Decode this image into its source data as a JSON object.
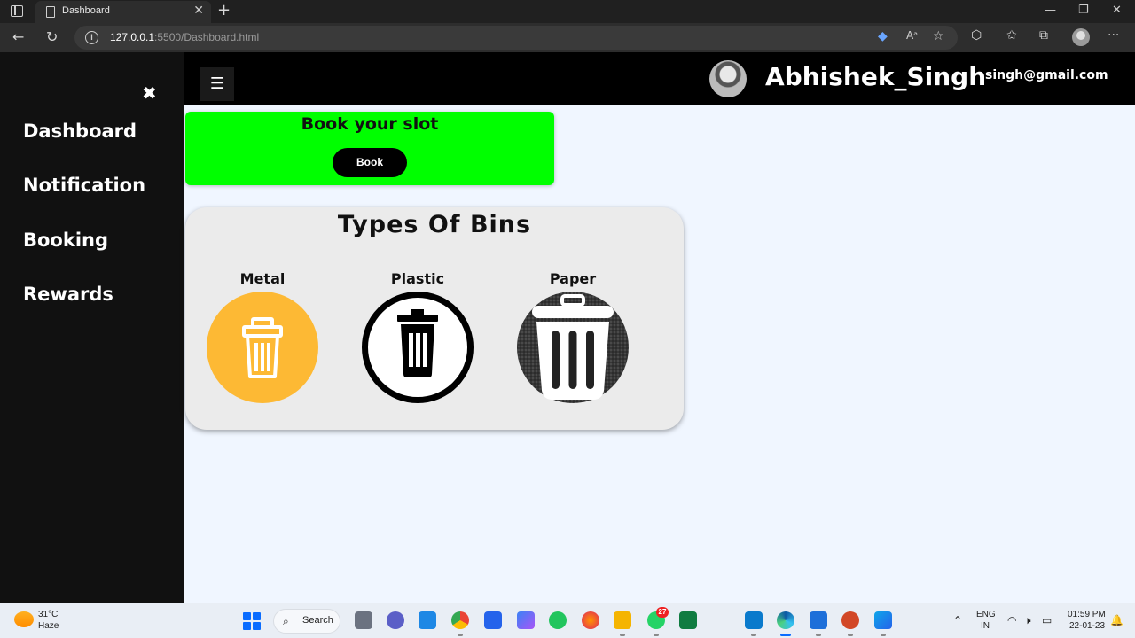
{
  "browser": {
    "tab_title": "Dashboard",
    "url_host": "127.0.0.1",
    "url_path": ":5500/Dashboard.html"
  },
  "sidebar": {
    "items": [
      {
        "label": "Dashboard"
      },
      {
        "label": "Notification"
      },
      {
        "label": "Booking"
      },
      {
        "label": "Rewards"
      }
    ]
  },
  "header": {
    "username": "Abhishek_Singh",
    "email": "singh@gmail.com"
  },
  "booking": {
    "title": "Book your slot",
    "button_label": "Book",
    "color": "#00ff00"
  },
  "bins": {
    "title": "Types Of Bins",
    "items": [
      {
        "label": "Metal",
        "color": "#fdb934",
        "icon": "trash-can-outline-icon"
      },
      {
        "label": "Plastic",
        "color": "#000000",
        "icon": "trash-can-circle-icon"
      },
      {
        "label": "Paper",
        "color": "#2a2a2a",
        "icon": "trash-can-textured-icon"
      }
    ]
  },
  "taskbar": {
    "weather_temp": "31°C",
    "weather_desc": "Haze",
    "search_label": "Search",
    "whatsapp_badge": "27",
    "lang_line1": "ENG",
    "lang_line2": "IN",
    "time": "01:59 PM",
    "date": "22-01-23"
  }
}
